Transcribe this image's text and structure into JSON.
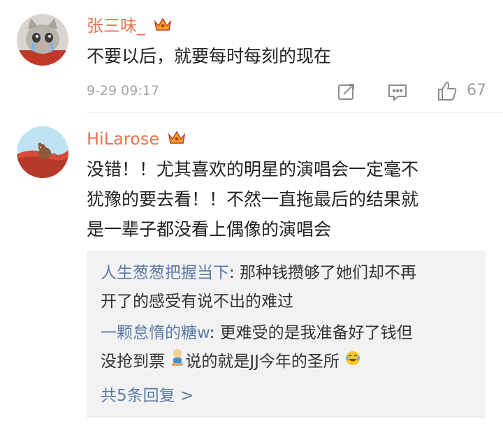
{
  "comments": [
    {
      "user": "张三味_",
      "text": "不要以后，就要每时每刻的现在",
      "time": "9-29 09:17",
      "likes": "67"
    },
    {
      "user": "HiLarose",
      "text_lines": [
        "没错！！尤其喜欢的明星的演唱会一定毫不",
        "犹豫的要去看！！不然一直拖最后的结果就",
        "是一辈子都没看上偶像的演唱会"
      ],
      "replies": [
        {
          "name": "人生葱葱把握当下",
          "line1": ": 那种钱攒够了她们却不再",
          "line2": "开了的感受有说不出的难过"
        },
        {
          "name": "一颗怠惰的糖w",
          "line1": ": 更难受的是我准备好了钱但",
          "line2a": "没抢到票",
          "line2b": "说的就是JJ今年的圣所"
        }
      ],
      "more_replies": "共5条回复 >"
    }
  ],
  "colors": {
    "username": "#eb7350",
    "reply_name": "#5b7ba8",
    "crown": "#f5a623"
  },
  "icons": [
    "cat-avatar",
    "cartoon-avatar",
    "crown-icon",
    "repost-icon",
    "comment-icon",
    "like-icon",
    "kneel-emoji-icon",
    "laugh-cry-emoji-icon"
  ]
}
